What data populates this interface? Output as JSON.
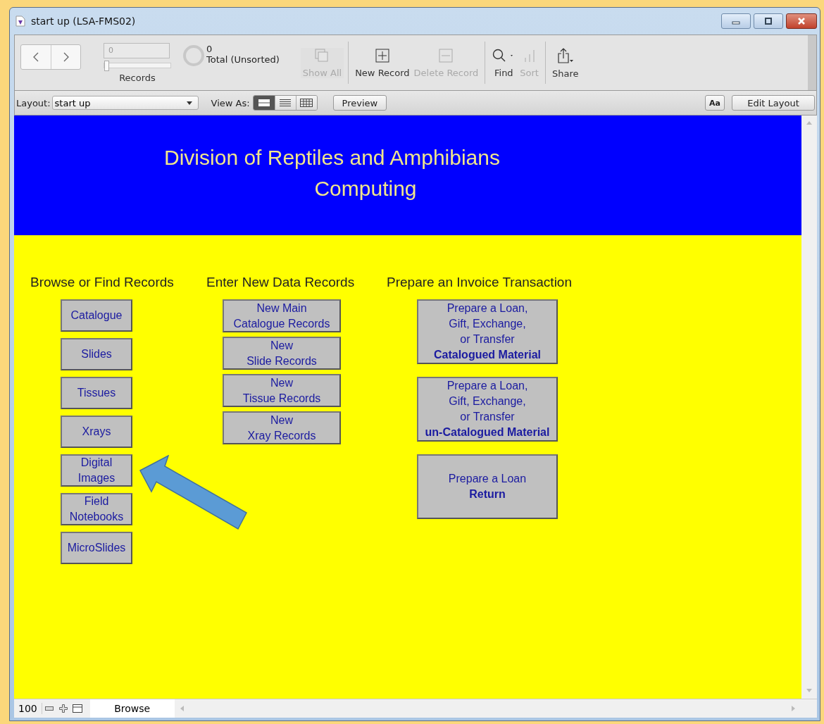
{
  "window": {
    "title": "start up (LSA-FMS02)"
  },
  "toolbar": {
    "records": {
      "value": "0",
      "level": 0,
      "label": "Records"
    },
    "found_count": "0",
    "found_label": "Total (Unsorted)",
    "items": [
      {
        "kind": "show-all",
        "label": "Show All",
        "disabled": true
      },
      {
        "kind": "new-record",
        "label": "New Record",
        "disabled": false
      },
      {
        "kind": "delete-record",
        "label": "Delete Record",
        "disabled": true
      },
      {
        "kind": "find",
        "label": "Find",
        "disabled": false
      },
      {
        "kind": "sort",
        "label": "Sort",
        "disabled": true
      },
      {
        "kind": "share",
        "label": "Share",
        "disabled": false
      }
    ]
  },
  "layout_bar": {
    "layout_label": "Layout:",
    "layout_value": "start up",
    "view_as_label": "View As:",
    "view_modes": [
      {
        "kind": "form",
        "selected": true
      },
      {
        "kind": "list",
        "selected": false
      },
      {
        "kind": "table",
        "selected": false
      }
    ],
    "preview": "Preview",
    "text_format": "Aa",
    "edit_layout": "Edit Layout"
  },
  "header": {
    "line_1": "Division of Reptiles and Amphibians",
    "line_2": "Computing"
  },
  "sections": [
    {
      "kind": "browse",
      "heading": "Browse or Find Records",
      "buttons": [
        {
          "lines": [
            "Catalogue"
          ]
        },
        {
          "lines": [
            "Slides"
          ]
        },
        {
          "lines": [
            "Tissues"
          ]
        },
        {
          "lines": [
            "Xrays"
          ]
        },
        {
          "lines": [
            "Digital",
            "Images"
          ]
        },
        {
          "lines": [
            "Field",
            "Notebooks"
          ]
        },
        {
          "lines": [
            "MicroSlides"
          ]
        }
      ]
    },
    {
      "kind": "enter",
      "heading": "Enter New Data Records",
      "buttons": [
        {
          "lines": [
            "New Main",
            "Catalogue Records"
          ]
        },
        {
          "lines": [
            "New",
            "Slide Records"
          ]
        },
        {
          "lines": [
            "New",
            "Tissue Records"
          ]
        },
        {
          "lines": [
            "New",
            "Xray Records"
          ]
        }
      ]
    },
    {
      "kind": "invoice",
      "heading": "Prepare an Invoice Transaction",
      "buttons": [
        {
          "lines": [
            "Prepare a Loan,",
            "Gift, Exchange,",
            "or Transfer",
            "**Catalogued Material**"
          ]
        },
        {
          "lines": [
            "Prepare a Loan,",
            "Gift, Exchange,",
            "or Transfer",
            "**un-Catalogued Material**"
          ]
        },
        {
          "lines": [
            "Prepare a Loan",
            "**Return**"
          ]
        }
      ]
    }
  ],
  "status_bar": {
    "zoom": "100",
    "mode": "Browse"
  }
}
